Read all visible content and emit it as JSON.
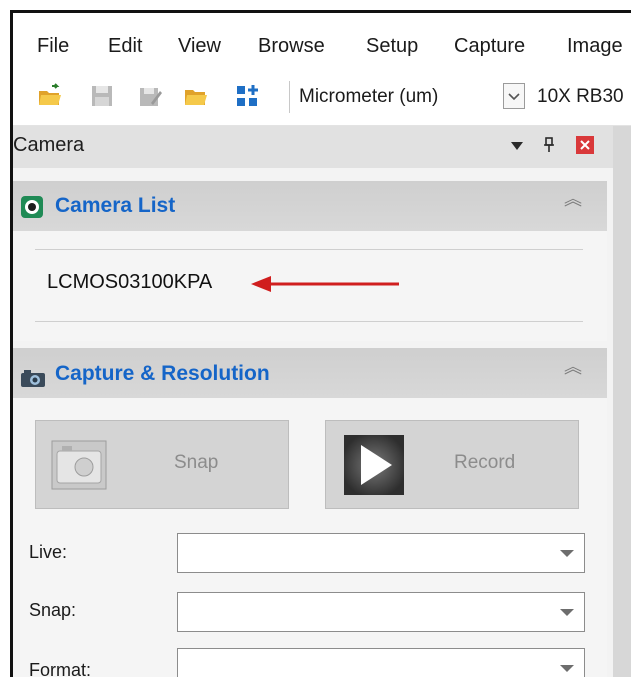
{
  "menu": {
    "items": [
      "File",
      "Edit",
      "View",
      "Browse",
      "Setup",
      "Capture",
      "Image"
    ]
  },
  "toolbar": {
    "icons": [
      "open-folder-icon",
      "save-icon",
      "save-as-icon",
      "browse-folder-icon",
      "layout-grid-icon"
    ],
    "unit_value": "Micrometer (um)",
    "lens_value": "10X RB30"
  },
  "camera_panel": {
    "title": "Camera",
    "icons": [
      "dropdown-arrow-icon",
      "pin-icon",
      "close-icon"
    ],
    "camera_list": {
      "title": "Camera List",
      "devices": [
        "LCMOS03100KPA"
      ]
    },
    "capture_resolution": {
      "title": "Capture & Resolution",
      "snap_label": "Snap",
      "record_label": "Record",
      "fields": [
        {
          "label": "Live:",
          "value": ""
        },
        {
          "label": "Snap:",
          "value": ""
        },
        {
          "label": "Format:",
          "value": ""
        }
      ]
    }
  },
  "colors": {
    "section_title": "#1565c8",
    "annotation_arrow": "#d01e1e",
    "close_button": "#d9383a"
  }
}
